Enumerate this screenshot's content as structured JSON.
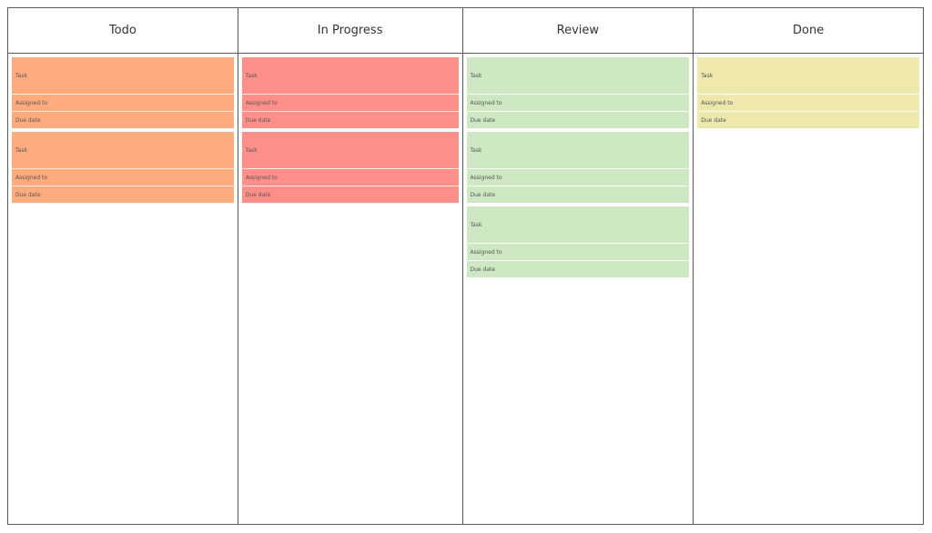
{
  "board": {
    "columns": [
      {
        "title": "Todo",
        "color": "#ffab7e",
        "cards": [
          {
            "task": "Task",
            "assigned": "Assigned to",
            "due": "Due date"
          },
          {
            "task": "Task",
            "assigned": "Assigned to",
            "due": "Due date"
          }
        ]
      },
      {
        "title": "In Progress",
        "color": "#ff8f88",
        "cards": [
          {
            "task": "Task",
            "assigned": "Assigned to",
            "due": "Due date"
          },
          {
            "task": "Task",
            "assigned": "Assigned to",
            "due": "Due date"
          }
        ]
      },
      {
        "title": "Review",
        "color": "#cde8c2",
        "cards": [
          {
            "task": "Task",
            "assigned": "Assigned to",
            "due": "Due date"
          },
          {
            "task": "Task",
            "assigned": "Assigned to",
            "due": "Due date"
          },
          {
            "task": "Task",
            "assigned": "Assigned to",
            "due": "Due date"
          }
        ]
      },
      {
        "title": "Done",
        "color": "#efe8ad",
        "cards": [
          {
            "task": "Task",
            "assigned": "Assigned to",
            "due": "Due date"
          }
        ]
      }
    ]
  }
}
